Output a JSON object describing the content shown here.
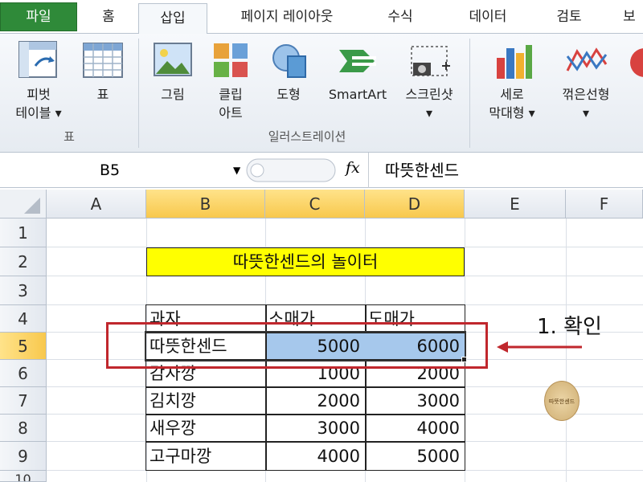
{
  "tabs": [
    "파일",
    "홈",
    "삽입",
    "페이지 레이아웃",
    "수식",
    "데이터",
    "검토",
    "보"
  ],
  "ribbon": {
    "pivot_label": "피벗\n테이블 ▾",
    "table_label": "표",
    "picture_label": "그림",
    "clipart_label": "클립\n아트",
    "shapes_label": "도형",
    "smartart_label": "SmartArt",
    "screenshot_label": "스크린샷\n▾",
    "column_label": "세로\n막대형 ▾",
    "line_label": "꺾은선형\n▾",
    "group_table": "표",
    "group_illustrations": "일러스트레이션"
  },
  "formula_bar": {
    "name_box": "B5",
    "fx": "fx",
    "content": "따뜻한센드"
  },
  "columns": [
    "A",
    "B",
    "C",
    "D",
    "E",
    "F"
  ],
  "rows": [
    "1",
    "2",
    "3",
    "4",
    "5",
    "6",
    "7",
    "8",
    "9",
    "10"
  ],
  "sheet": {
    "title": "따뜻한센드의 놀이터",
    "headers": [
      "과자",
      "소매가",
      "도매가"
    ],
    "items": [
      {
        "name": "따뜻한센드",
        "retail": "5000",
        "wholesale": "6000"
      },
      {
        "name": "감자깡",
        "retail": "1000",
        "wholesale": "2000"
      },
      {
        "name": "김치깡",
        "retail": "2000",
        "wholesale": "3000"
      },
      {
        "name": "새우깡",
        "retail": "3000",
        "wholesale": "4000"
      },
      {
        "name": "고구마깡",
        "retail": "4000",
        "wholesale": "5000"
      }
    ]
  },
  "annotation": {
    "text": "1. 확인",
    "color": "#c0272d"
  },
  "stamp_text": "따뜻한센드",
  "colors": {
    "file_tab": "#2f8a39",
    "title_fill": "#ffff00",
    "selection": "#a6c8ec",
    "header_selected": "#f8c84d"
  }
}
